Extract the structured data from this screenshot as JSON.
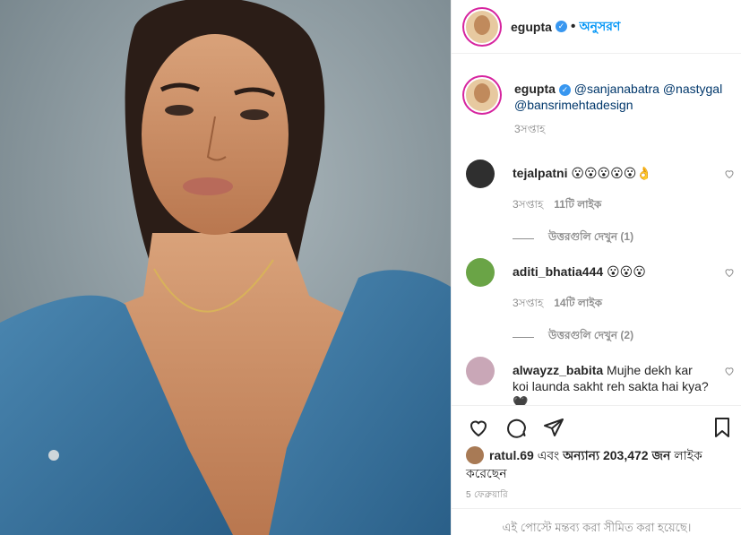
{
  "post": {
    "photo_alt": "",
    "header": {
      "username": "egupta",
      "separator": "•",
      "follow_label": "অনুসরণ"
    },
    "caption": {
      "username": "egupta",
      "mentions": [
        "@sanjanabatra",
        "@nastygal",
        "@bansrimehtadesign"
      ],
      "timestamp": "3সপ্তাহ"
    },
    "comments": [
      {
        "username": "tejalpatni",
        "text": "😮😮😮😮😮👌",
        "timestamp": "3সপ্তাহ",
        "likes": "11টি লাইক",
        "replies": "উত্তরগুলি দেখুন (1)"
      },
      {
        "username": "aditi_bhatia444",
        "text": "😮😮😮",
        "timestamp": "3সপ্তাহ",
        "likes": "14টি লাইক",
        "replies": "উত্তরগুলি দেখুন (2)"
      },
      {
        "username": "alwayzz_babita",
        "text": "Mujhe dekh kar koi launda sakht reh sakta hai kya?🖤"
      }
    ],
    "likes_text": {
      "user": "ratul.69",
      "middle": " এবং ",
      "others": "অন্যান্য 203,472 জন",
      "suffix": " লাইক করেছেন"
    },
    "date": "5 ফেব্রুয়ারি",
    "restricted_notice": "এই পোস্টে মন্তব্য করা সীমিত করা হয়েছে।"
  },
  "colors": {
    "accent": "#0095f6",
    "verified": "#3897f0",
    "muted": "#8e8e8e",
    "text": "#262626"
  },
  "icons": {
    "heart": "heart-icon",
    "comment": "comment-icon",
    "share": "share-icon",
    "save": "bookmark-icon",
    "verified": "verified-badge-icon"
  }
}
